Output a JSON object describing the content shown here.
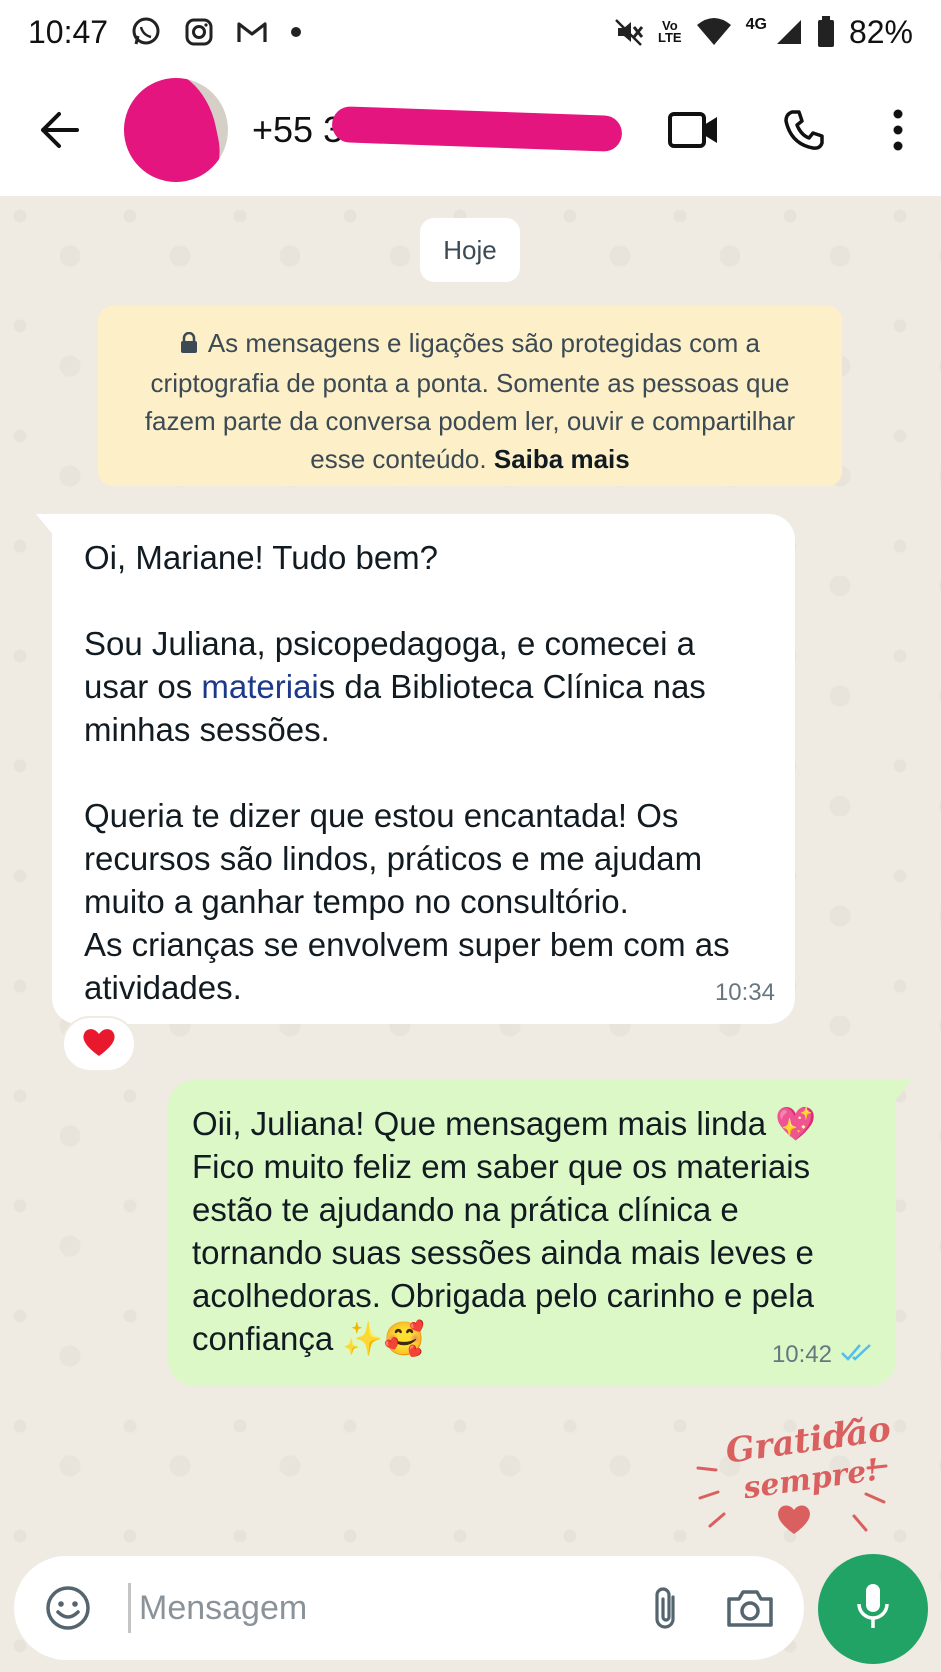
{
  "status_bar": {
    "time": "10:47",
    "network_label": "4G",
    "volte_label": "Vo\nLTE",
    "battery": "82%"
  },
  "header": {
    "contact_name": "+55 31 9 8763-1521",
    "icons": [
      "back-arrow-icon",
      "video-call-icon",
      "phone-icon",
      "more-options-icon"
    ]
  },
  "chat": {
    "date_chip": "Hoje",
    "encryption_notice": {
      "text": "As mensagens e ligações são protegidas com a criptografia de ponta a ponta. Somente as pessoas que fazem parte da conversa podem ler, ouvir e compartilhar esse conteúdo.",
      "link": "Saiba mais"
    },
    "incoming": {
      "greeting": "Oi, Mariane! Tudo bem?",
      "para2_before": "Sou Juliana, psicopedagoga, e comecei a usar os ",
      "para2_link": "materiai",
      "para2_after": "s da Biblioteca Clínica nas minhas sessões.",
      "para3": "Queria te dizer que estou encantada! Os recursos são lindos, práticos e me ajudam muito a ganhar tempo no consultório.",
      "para4": "As crianças se envolvem super bem com as atividades.",
      "time": "10:34",
      "reaction": "❤️"
    },
    "outgoing": {
      "line1": "Oii, Juliana! Que mensagem mais linda 💖",
      "line2": "Fico muito feliz em saber que os materiais estão te ajudando na prática clínica e tornando suas sessões ainda mais leves e acolhedoras. Obrigada pelo carinho e pela confiança ✨🥰",
      "time": "10:42",
      "status": "read"
    },
    "sticker": {
      "line1": "Gratidão",
      "line2": "sempre!"
    }
  },
  "input": {
    "placeholder": "Mensagem"
  },
  "colors": {
    "chat_background": "#efeae2",
    "outgoing_bubble": "#dcf8c6",
    "notice_background": "#fdf0c8",
    "accent_green": "#21a366",
    "read_ticks": "#53bdeb",
    "sticker_text": "#d9605e",
    "redaction": "#e4157f"
  }
}
